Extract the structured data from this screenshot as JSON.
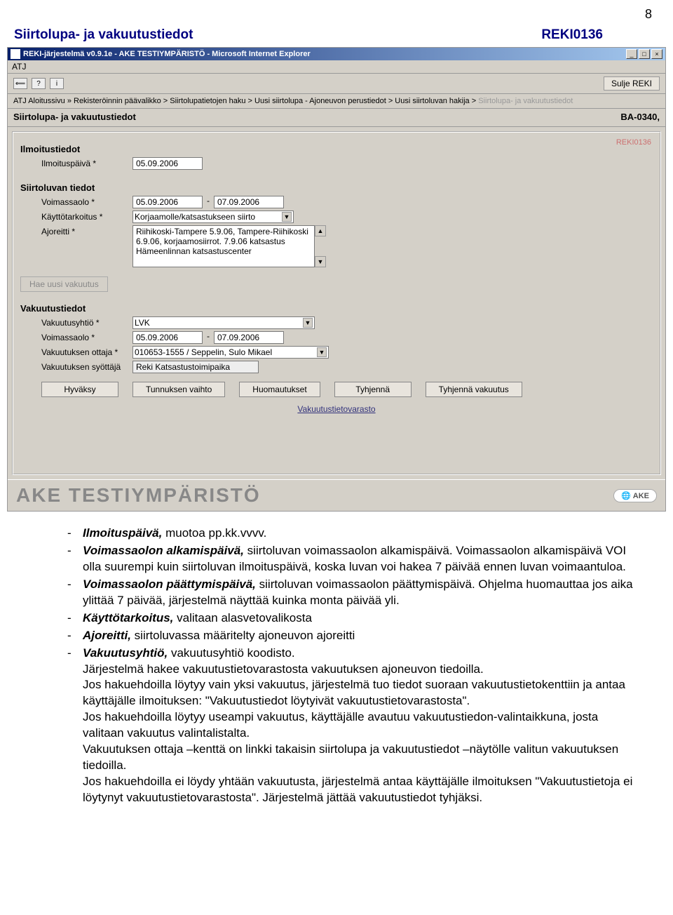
{
  "pageNumber": "8",
  "docTitle": "Siirtolupa- ja vakuutustiedot",
  "docCode": "REKI0136",
  "window": {
    "title": "REKI-järjestelmä v0.9.1e - AKE TESTIYMPÄRISTÖ - Microsoft Internet Explorer",
    "menu": "ATJ",
    "helpIcon": "?",
    "infoIcon": "i",
    "closeBtn": "Sulje REKI",
    "breadcrumb": {
      "path": "ATJ Aloitussivu » Rekisteröinnin päävalikko > Siirtolupatietojen haku > Uusi siirtolupa - Ajoneuvon perustiedot > Uusi siirtoluvan hakija > ",
      "current": "Siirtolupa- ja vakuutustiedot"
    },
    "pageTitle": "Siirtolupa- ja vakuutustiedot",
    "reg": "BA-0340,",
    "panelCode": "REKI0136"
  },
  "ilmoitustiedot": {
    "heading": "Ilmoitustiedot",
    "dateLabel": "Ilmoituspäivä *",
    "dateValue": "05.09.2006"
  },
  "siirtoluvan": {
    "heading": "Siirtoluvan tiedot",
    "voimLabel": "Voimassaolo *",
    "voimFrom": "05.09.2006",
    "voimTo": "07.09.2006",
    "kayttoLabel": "Käyttötarkoitus *",
    "kayttoValue": "Korjaamolle/katsastukseen siirto",
    "ajoLabel": "Ajoreitti *",
    "ajoValue": "Riihikoski-Tampere 5.9.06, Tampere-Riihikoski 6.9.06, korjaamosiirrot. 7.9.06 katsastus Hämeenlinnan katsastuscenter"
  },
  "haeBtnLabel": "Hae uusi vakuutus",
  "vakuutustiedot": {
    "heading": "Vakuutustiedot",
    "yhtioLabel": "Vakuutusyhtiö *",
    "yhtioValue": "LVK",
    "voimLabel": "Voimassaolo *",
    "voimFrom": "05.09.2006",
    "voimTo": "07.09.2006",
    "ottajaLabel": "Vakuutuksen ottaja *",
    "ottajaValue": "010653-1555 / Seppelin, Sulo Mikael",
    "syottajaLabel": "Vakuutuksen syöttäjä",
    "syottajaValue": "Reki Katsastustoimipaika"
  },
  "buttons": {
    "hyvaksy": "Hyväksy",
    "tunnuksen": "Tunnuksen vaihto",
    "huom": "Huomautukset",
    "tyhj": "Tyhjennä",
    "tyhjVak": "Tyhjennä vakuutus"
  },
  "link": "Vakuutustietovarasto",
  "footerText": "AKE TESTIYMPÄRISTÖ",
  "footerLogo": "AKE",
  "bullets": [
    {
      "bold": "Ilmoituspäivä,",
      "rest": " muotoa pp.kk.vvvv."
    },
    {
      "bold": "Voimassaolon alkamispäivä,",
      "rest": " siirtoluvan voimassaolon alkamispäivä. Voimassaolon alkamispäivä VOI olla suurempi kuin siirtoluvan ilmoituspäivä, koska luvan voi hakea 7 päivää ennen luvan voimaantuloa."
    },
    {
      "bold": "Voimassaolon päättymispäivä,",
      "rest": " siirtoluvan voimassaolon päättymispäivä. Ohjelma huomauttaa jos aika ylittää 7 päivää, järjestelmä näyttää kuinka monta päivää yli."
    },
    {
      "bold": "Käyttötarkoitus,",
      "rest": " valitaan alasvetovalikosta"
    },
    {
      "bold": "Ajoreitti,",
      "rest": " siirtoluvassa määritelty ajoneuvon ajoreitti"
    },
    {
      "bold": "Vakuutusyhtiö,",
      "rest": " vakuutusyhtiö koodisto.",
      "extra": "Järjestelmä hakee vakuutustietovarastosta vakuutuksen ajoneuvon tiedoilla.\nJos hakuehdoilla löytyy vain yksi vakuutus, järjestelmä tuo tiedot suoraan vakuutustietokenttiin ja antaa käyttäjälle ilmoituksen: \"Vakuutustiedot löytyivät vakuutustietovarastosta\".\nJos hakuehdoilla löytyy useampi vakuutus, käyttäjälle avautuu vakuutustiedon-valintaikkuna, josta valitaan vakuutus valintalistalta.\nVakuutuksen ottaja –kenttä on linkki takaisin siirtolupa ja vakuutustiedot –näytölle valitun vakuutuksen tiedoilla.\nJos hakuehdoilla ei löydy yhtään vakuutusta, järjestelmä antaa käyttäjälle ilmoituksen \"Vakuutustietoja ei löytynyt vakuutustietovarastosta\". Järjestelmä jättää vakuutustiedot tyhjäksi."
    }
  ]
}
